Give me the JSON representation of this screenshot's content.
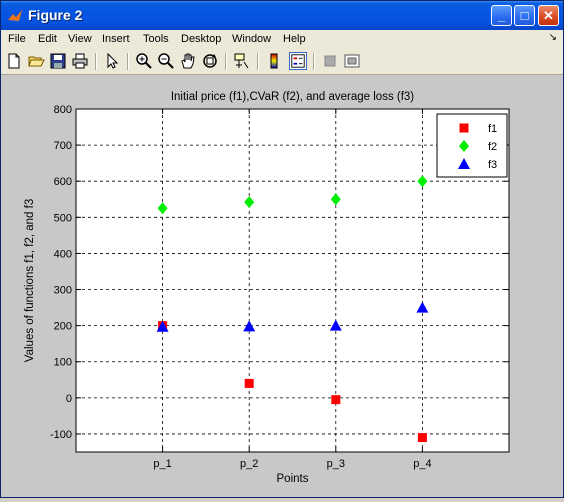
{
  "window": {
    "title": "Figure 2",
    "minimize_label": "_",
    "maximize_label": "□",
    "close_label": "✕"
  },
  "menubar": {
    "items": [
      "File",
      "Edit",
      "View",
      "Insert",
      "Tools",
      "Desktop",
      "Window",
      "Help"
    ],
    "arrow": "↘"
  },
  "toolbar": {
    "buttons": [
      "new-figure-icon",
      "open-file-icon",
      "save-icon",
      "print-icon",
      "edit-plot-arrow-icon",
      "zoom-in-icon",
      "zoom-out-icon",
      "pan-hand-icon",
      "rotate-3d-icon",
      "data-cursor-icon",
      "colorbar-icon",
      "legend-icon",
      "hide-plot-tools-icon",
      "show-plot-tools-icon"
    ]
  },
  "colors": {
    "f1": "#ff0000",
    "f2": "#00ee00",
    "f3": "#0000ff",
    "figure_bg": "#c8c8c8",
    "titlebar": "#0554e3"
  },
  "chart_data": {
    "type": "scatter",
    "title": "Initial price (f1),CVaR (f2), and average loss (f3)",
    "xlabel": "Points",
    "ylabel": "Values of functions f1, f2, and f3",
    "categories": [
      "p_1",
      "p_2",
      "p_3",
      "p_4"
    ],
    "ylim": [
      -150,
      800
    ],
    "yticks": [
      -100,
      0,
      100,
      200,
      300,
      400,
      500,
      600,
      700,
      800
    ],
    "grid": true,
    "legend_position": "top-right",
    "series": [
      {
        "name": "f1",
        "marker": "square",
        "color": "#ff0000",
        "values": [
          200,
          40,
          -5,
          -110
        ]
      },
      {
        "name": "f2",
        "marker": "diamond",
        "color": "#00ee00",
        "values": [
          525,
          542,
          550,
          600
        ]
      },
      {
        "name": "f3",
        "marker": "triangle",
        "color": "#0000ff",
        "values": [
          197,
          198,
          200,
          250
        ]
      }
    ]
  }
}
